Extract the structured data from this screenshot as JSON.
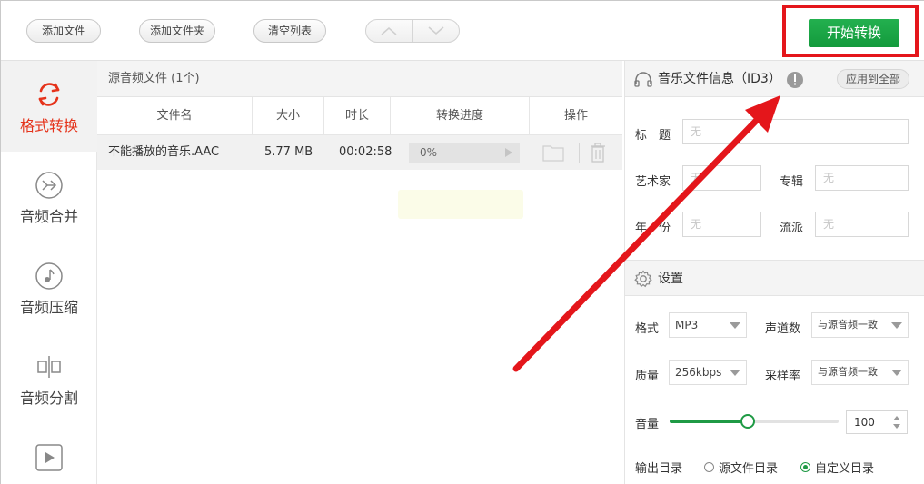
{
  "toolbar": {
    "add_file": "添加文件",
    "add_folder": "添加文件夹",
    "clear_list": "清空列表",
    "start": "开始转换"
  },
  "sidebar": {
    "items": [
      {
        "label": "格式转换",
        "active": true
      },
      {
        "label": "音频合并"
      },
      {
        "label": "音频压缩"
      },
      {
        "label": "音频分割"
      }
    ]
  },
  "file_list": {
    "header": "源音频文件 (1个)",
    "columns": [
      "文件名",
      "大小",
      "时长",
      "转换进度",
      "操作"
    ],
    "rows": [
      {
        "name": "不能播放的音乐.AAC",
        "size": "5.77 MB",
        "duration": "00:02:58",
        "progress": "0%"
      }
    ]
  },
  "id3": {
    "title": "音乐文件信息（ID3）",
    "apply_all": "应用到全部",
    "title_label": "标　题",
    "artist_label": "艺术家",
    "album_label": "专辑",
    "year_label": "年　份",
    "genre_label": "流派",
    "placeholder": "无"
  },
  "settings": {
    "title": "设置",
    "format_label": "格式",
    "format_value": "MP3",
    "channels_label": "声道数",
    "channels_value": "与源音频一致",
    "quality_label": "质量",
    "quality_value": "256kbps",
    "samplerate_label": "采样率",
    "samplerate_value": "与源音频一致",
    "volume_label": "音量",
    "volume_value": "100",
    "volume_fraction": 0.46,
    "output_label": "输出目录",
    "output_source": "源文件目录",
    "output_custom": "自定义目录"
  },
  "colors": {
    "accent_green": "#1f9a45",
    "highlight_red": "#e4161b",
    "active_nav": "#e5331b"
  }
}
